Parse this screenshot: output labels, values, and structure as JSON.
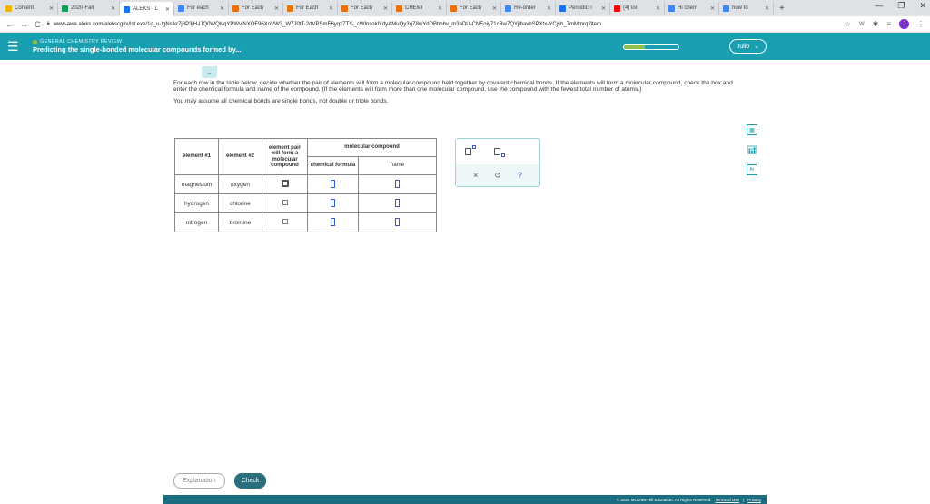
{
  "browser": {
    "tabs": [
      {
        "label": "Content",
        "color": "#f4b400"
      },
      {
        "label": "2020-Fall",
        "color": "#0f9d58"
      },
      {
        "label": "ALEKS - L",
        "color": "#1a73e8",
        "active": true
      },
      {
        "label": "For each",
        "color": "#4285f4"
      },
      {
        "label": "For Each",
        "color": "#e8710a"
      },
      {
        "label": "For Each",
        "color": "#e8710a"
      },
      {
        "label": "For Each",
        "color": "#e8710a"
      },
      {
        "label": "CHEMI",
        "color": "#e8710a"
      },
      {
        "label": "For Each",
        "color": "#e8710a"
      },
      {
        "label": "Re-order",
        "color": "#4285f4"
      },
      {
        "label": "Periodic T",
        "color": "#1a73e8"
      },
      {
        "label": "(4) lol",
        "color": "#ff0000"
      },
      {
        "label": "Hi chem",
        "color": "#4285f4"
      },
      {
        "label": "how to",
        "color": "#4285f4"
      }
    ],
    "new_tab": "+",
    "window_controls": [
      "—",
      "❐",
      "✕"
    ],
    "url": "www-awa.aleks.com/alekscgi/x/Isl.exe/1o_u-IgNslkr7j8P3jH-lJQ0WQlvqYPWvlNXOF96XoVW3_W7J0tT-2dVPSmE6yqz7TY-_cWlnsoklYdyAMuQy3qZ8wYdDBbnhv_m3aDU-CNEoiy71cBw7QYjlbavbSPXtx-YCjsh_7mMmrq?item",
    "avatar_letter": "J"
  },
  "header": {
    "topic": "GENERAL CHEMISTRY REVIEW",
    "title": "Predicting the single-bonded molecular compounds formed by...",
    "progress_fraction": 0.38,
    "user": "Julio"
  },
  "content": {
    "instructions": "For each row in the table below, decide whether the pair of elements will form a molecular compound held together by covalent chemical bonds. If the elements will form a molecular compound, check the box and enter the chemical formula and name of the compound. (If the elements will form more than one molecular compound, use the compound with the fewest total number of atoms.)",
    "note": "You may assume all chemical bonds are single bonds, not double or triple bonds."
  },
  "table": {
    "headers": {
      "element1": "element #1",
      "element2": "element #2",
      "pair": "element pair will form a molecular compound",
      "compound": "molecular compound",
      "formula": "chemical formula",
      "name": "name"
    },
    "rows": [
      {
        "element1": "magnesium",
        "element2": "oxygen"
      },
      {
        "element1": "hydrogen",
        "element2": "chlorine"
      },
      {
        "element1": "nitrogen",
        "element2": "bromine"
      }
    ]
  },
  "tools": {
    "clear": "×",
    "undo": "↺",
    "help": "?"
  },
  "buttons": {
    "explanation": "Explanation",
    "check": "Check"
  },
  "footer": {
    "copyright": "© 2020 McGraw-Hill Education. All Rights Reserved.",
    "terms": "Terms of Use",
    "separator": "|",
    "privacy": "Privacy"
  }
}
